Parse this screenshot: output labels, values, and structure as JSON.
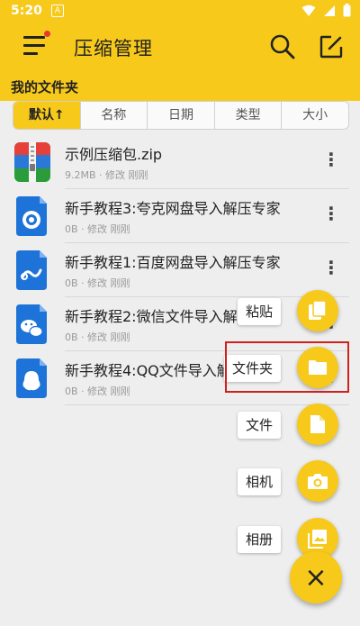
{
  "status_bar": {
    "time": "5:20",
    "notif_icon_text": "A"
  },
  "app_bar": {
    "title": "压缩管理",
    "icons": [
      "menu-icon",
      "search-icon",
      "edit-icon"
    ]
  },
  "section": {
    "title": "我的文件夹"
  },
  "sort_tabs": [
    {
      "label": "默认↑",
      "active": true
    },
    {
      "label": "名称",
      "active": false
    },
    {
      "label": "日期",
      "active": false
    },
    {
      "label": "类型",
      "active": false
    },
    {
      "label": "大小",
      "active": false
    }
  ],
  "files": [
    {
      "name": "示例压缩包.zip",
      "meta": "9.2MB · 修改 刚刚",
      "icon": "zip-archive-icon"
    },
    {
      "name": "新手教程3:夸克网盘导入解压专家",
      "meta": "0B · 修改 刚刚",
      "icon": "quark-doc-icon"
    },
    {
      "name": "新手教程1:百度网盘导入解压专家",
      "meta": "0B · 修改 刚刚",
      "icon": "baidu-doc-icon"
    },
    {
      "name": "新手教程2:微信文件导入解压专家",
      "meta": "0B · 修改 刚刚",
      "icon": "wechat-doc-icon"
    },
    {
      "name": "新手教程4:QQ文件导入解压专家",
      "meta": "0B · 修改 刚刚",
      "icon": "qq-doc-icon"
    }
  ],
  "fab_menu": {
    "paste": {
      "label": "粘贴",
      "icon": "paste-icon"
    },
    "folder": {
      "label": "文件夹",
      "icon": "folder-icon"
    },
    "file": {
      "label": "文件",
      "icon": "file-icon"
    },
    "camera": {
      "label": "相机",
      "icon": "camera-icon"
    },
    "album": {
      "label": "相册",
      "icon": "album-icon"
    },
    "close": {
      "label": "×",
      "icon": "close-icon"
    }
  },
  "colors": {
    "accent": "#f6c91b",
    "highlight": "#d0211c",
    "file_blue": "#1e73d8"
  }
}
